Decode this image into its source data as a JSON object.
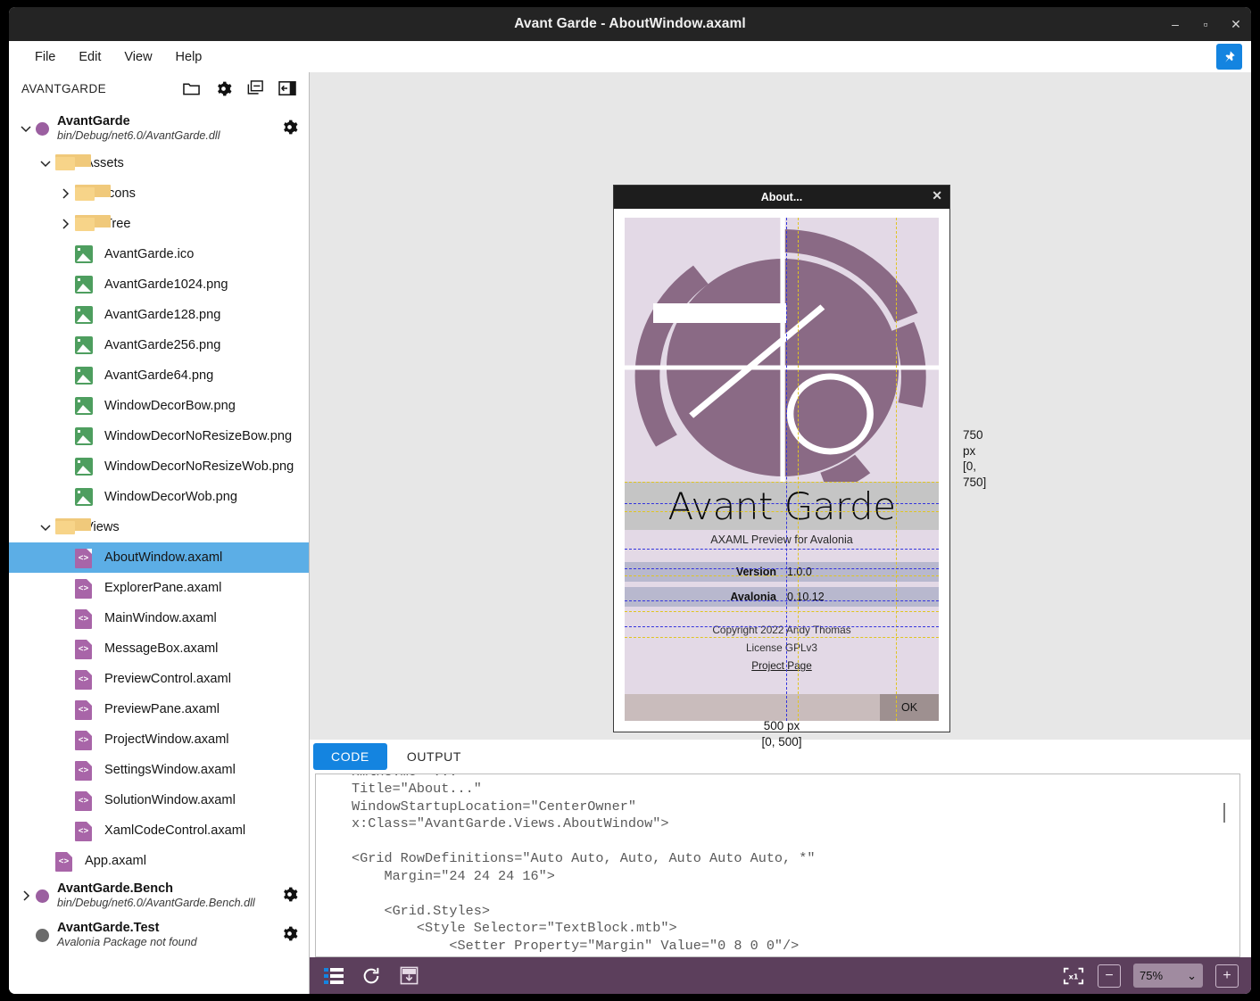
{
  "window": {
    "title": "Avant Garde - AboutWindow.axaml",
    "minimize": "–",
    "maximize": "▫",
    "close": "✕"
  },
  "menubar": {
    "items": [
      {
        "label": "File"
      },
      {
        "label": "Edit"
      },
      {
        "label": "View"
      },
      {
        "label": "Help"
      }
    ],
    "pin_icon": "pin-icon"
  },
  "sidebar": {
    "title": "AVANTGARDE",
    "tools": [
      {
        "name": "open-folder-icon"
      },
      {
        "name": "settings-gear-icon"
      },
      {
        "name": "collapse-all-icon"
      },
      {
        "name": "toggle-pane-icon"
      }
    ],
    "tree": [
      {
        "kind": "project",
        "name": "AvantGarde",
        "sub": "bin/Debug/net6.0/AvantGarde.dll",
        "chevron": "⌄",
        "dot_color": "#9b5fa0",
        "gear": true,
        "indent": 0
      },
      {
        "kind": "folder",
        "name": "Assets",
        "chevron": "⌄",
        "indent": 1
      },
      {
        "kind": "folder",
        "name": "Icons",
        "chevron": "›",
        "indent": 2
      },
      {
        "kind": "folder",
        "name": "Tree",
        "chevron": "›",
        "indent": 2
      },
      {
        "kind": "image",
        "name": "AvantGarde.ico",
        "indent": 2
      },
      {
        "kind": "image",
        "name": "AvantGarde1024.png",
        "indent": 2
      },
      {
        "kind": "image",
        "name": "AvantGarde128.png",
        "indent": 2
      },
      {
        "kind": "image",
        "name": "AvantGarde256.png",
        "indent": 2
      },
      {
        "kind": "image",
        "name": "AvantGarde64.png",
        "indent": 2
      },
      {
        "kind": "image",
        "name": "WindowDecorBow.png",
        "indent": 2
      },
      {
        "kind": "image",
        "name": "WindowDecorNoResizeBow.png",
        "indent": 2
      },
      {
        "kind": "image",
        "name": "WindowDecorNoResizeWob.png",
        "indent": 2
      },
      {
        "kind": "image",
        "name": "WindowDecorWob.png",
        "indent": 2
      },
      {
        "kind": "folder",
        "name": "Views",
        "chevron": "⌄",
        "indent": 1
      },
      {
        "kind": "xaml",
        "name": "AboutWindow.axaml",
        "indent": 2,
        "selected": true
      },
      {
        "kind": "xaml",
        "name": "ExplorerPane.axaml",
        "indent": 2
      },
      {
        "kind": "xaml",
        "name": "MainWindow.axaml",
        "indent": 2
      },
      {
        "kind": "xaml",
        "name": "MessageBox.axaml",
        "indent": 2
      },
      {
        "kind": "xaml",
        "name": "PreviewControl.axaml",
        "indent": 2
      },
      {
        "kind": "xaml",
        "name": "PreviewPane.axaml",
        "indent": 2
      },
      {
        "kind": "xaml",
        "name": "ProjectWindow.axaml",
        "indent": 2
      },
      {
        "kind": "xaml",
        "name": "SettingsWindow.axaml",
        "indent": 2
      },
      {
        "kind": "xaml",
        "name": "SolutionWindow.axaml",
        "indent": 2
      },
      {
        "kind": "xaml",
        "name": "XamlCodeControl.axaml",
        "indent": 2
      },
      {
        "kind": "xaml",
        "name": "App.axaml",
        "indent": 1
      },
      {
        "kind": "project",
        "name": "AvantGarde.Bench",
        "sub": "bin/Debug/net6.0/AvantGarde.Bench.dll",
        "chevron": "›",
        "dot_color": "#9b5fa0",
        "gear": true,
        "indent": 0
      },
      {
        "kind": "project",
        "name": "AvantGarde.Test",
        "sub": "Avalonia Package not found",
        "chevron": "",
        "dot_color": "#6b6b6b",
        "gear": true,
        "indent": 0
      }
    ]
  },
  "preview": {
    "dialog_title": "About...",
    "close_icon": "✕",
    "logo_alt": "avantgarde-logo",
    "brand": "Avant Garde",
    "tagline": "AXAML Preview for Avalonia",
    "fields": [
      {
        "key": "Version",
        "value": "1.0.0"
      },
      {
        "key": "Avalonia",
        "value": "0.10.12"
      }
    ],
    "copyright": "Copyright 2022 Andy Thomas",
    "license": "License GPLv3",
    "project_link": "Project Page",
    "ok_label": "OK",
    "dim_height_px": "750 px",
    "dim_height_range": "[0, 750]",
    "dim_width_px": "500 px",
    "dim_width_range": "[0, 500]"
  },
  "tabs": [
    {
      "label": "CODE",
      "active": true
    },
    {
      "label": "OUTPUT",
      "active": false
    }
  ],
  "code": "xmlns:mc=\"...\"\nTitle=\"About...\"\nWindowStartupLocation=\"CenterOwner\"\nx:Class=\"AvantGarde.Views.AboutWindow\">\n\n<Grid RowDefinitions=\"Auto Auto, Auto, Auto Auto Auto, *\"\n    Margin=\"24 24 24 16\">\n\n    <Grid.Styles>\n        <Style Selector=\"TextBlock.mtb\">\n            <Setter Property=\"Margin\" Value=\"0 8 0 0\"/>",
  "bottom_toolbar": {
    "tools": [
      {
        "name": "list-view-icon"
      },
      {
        "name": "refresh-icon"
      },
      {
        "name": "save-image-icon"
      }
    ],
    "fit_icon": "fit-to-actual-size-icon",
    "zoom_out": "−",
    "zoom_level": "75%",
    "zoom_chevron": "⌄",
    "zoom_in": "+"
  },
  "colors": {
    "accent": "#1484e0",
    "selection": "#5caee6",
    "brand_purple": "#8a6a85",
    "toolbar_purple": "#5c3f5c"
  }
}
